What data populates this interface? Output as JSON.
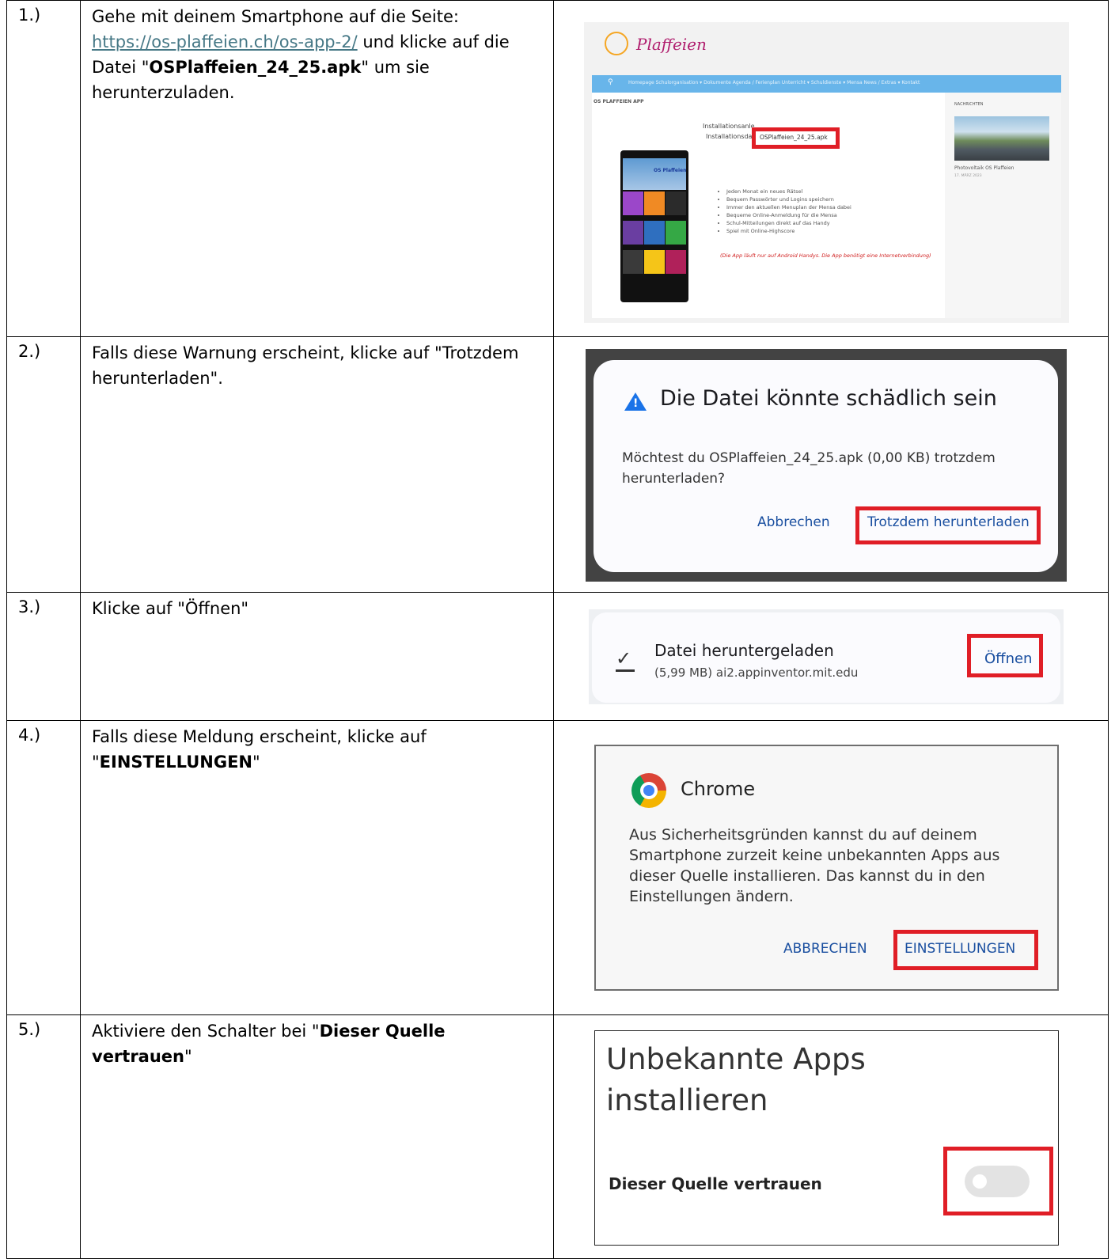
{
  "steps": [
    {
      "number": "1.)",
      "text_before_link": "Gehe mit deinem Smartphone auf die Seite:",
      "link": "https://os-plaffeien.ch/os-app-2/",
      "text_mid": " und klicke auf die Datei \"",
      "bold": "OSPlaffeien_24_25.apk",
      "text_after": "\" um sie herunterzuladen."
    },
    {
      "number": "2.)",
      "text": "Falls diese Warnung erscheint, klicke auf \"Trotzdem herunterladen\"."
    },
    {
      "number": "3.)",
      "text": "Klicke auf \"Öffnen\""
    },
    {
      "number": "4.)",
      "text_before": "Falls diese Meldung erscheint, klicke auf \"",
      "bold": "EINSTELLUNGEN",
      "text_after": "\""
    },
    {
      "number": "5.)",
      "text_before": "Aktiviere den Schalter bei \"",
      "bold": "Dieser Quelle vertrauen",
      "text_after": "\""
    }
  ],
  "screens": {
    "website": {
      "logo": "Plaffeien",
      "nav": "Homepage   Schulorganisation ▾   Dokumente   Agenda / Ferienplan   Unterricht ▾   Schuldienste ▾   Mensa   News / Extras ▾   Kontakt",
      "page_label": "OS PLAFFEIEN APP",
      "installation_line1": "Installationsanle",
      "installation_line2": "Installationsdat",
      "file_link": "OSPlaffeien_24_25.apk",
      "features": [
        "Jeden Monat ein neues Rätsel",
        "Bequem Passwörter und Logins speichern",
        "Immer den aktuellen Menuplan der Mensa dabei",
        "Bequeme Online-Anmeldung für die Mensa",
        "Schul-Mitteilungen direkt auf das Handy",
        "Spiel mit Online-Highscore"
      ],
      "note": "(Die App läuft nur auf Android Handys. Die App benötigt eine Internetverbindung)",
      "sidebar_heading": "NACHRICHTEN",
      "sidebar_news": "Photovoltaik OS Plaffeien",
      "sidebar_date": "17. MÄRZ 2023",
      "phone_title": "OS Plaffeien"
    },
    "warning_dialog": {
      "title": "Die Datei könnte schädlich sein",
      "body": "Möchtest du OSPlaffeien_24_25.apk (0,00 KB) trotzdem herunterladen?",
      "cancel": "Abbrechen",
      "confirm": "Trotzdem herunterladen"
    },
    "download_notice": {
      "title": "Datei heruntergeladen",
      "subtitle": "(5,99 MB) ai2.appinventor.mit.edu",
      "action": "Öffnen"
    },
    "chrome_dialog": {
      "title": "Chrome",
      "body": "Aus Sicherheitsgründen kannst du auf deinem Smartphone zurzeit keine unbekannten Apps aus dieser Quelle installieren. Das kannst du in den Einstellungen ändern.",
      "cancel": "ABBRECHEN",
      "settings": "EINSTELLUNGEN"
    },
    "settings_screen": {
      "title": "Unbekannte Apps installieren",
      "toggle_label": "Dieser Quelle vertrauen",
      "toggle_on": false
    }
  },
  "colors": {
    "highlight": "#e01e26",
    "link": "#467886",
    "button_text": "#1a4fa0"
  }
}
